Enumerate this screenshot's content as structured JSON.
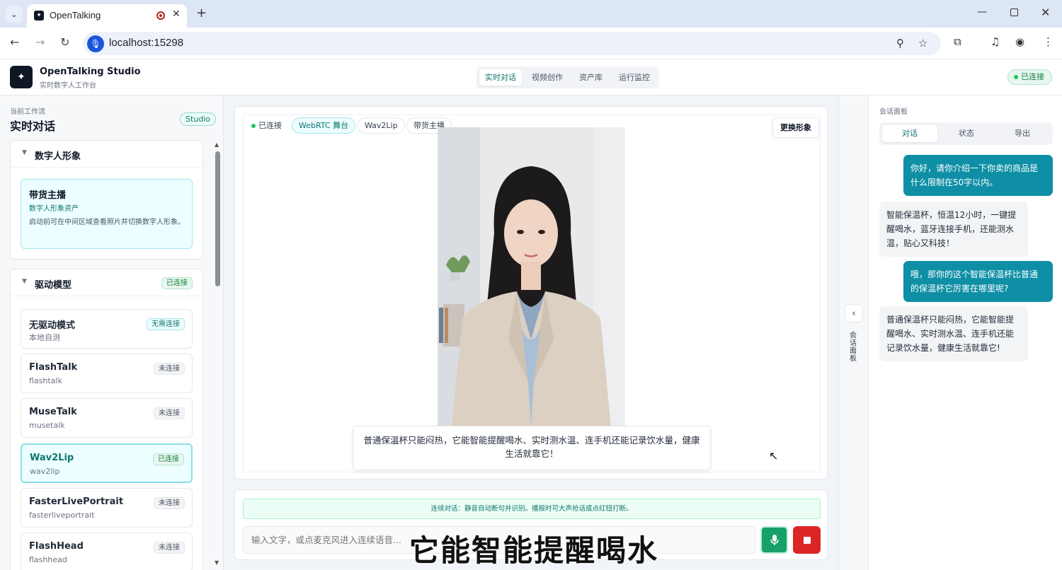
{
  "browser": {
    "tab_title": "OpenTalking",
    "url": "localhost:15298"
  },
  "header": {
    "brand_title": "OpenTalking Studio",
    "brand_subtitle": "实时数字人工作台",
    "tabs": [
      "实时对话",
      "视频创作",
      "资产库",
      "运行监控"
    ],
    "active_tab": "实时对话",
    "status": "已连接"
  },
  "sidebar": {
    "workflow_label": "当前工作流",
    "workflow_title": "实时对话",
    "studio_badge": "Studio",
    "avatar_panel": {
      "title": "数字人形象",
      "card_name": "带货主播",
      "card_subtitle": "数字人形象资产",
      "card_desc": "启动前可在中间区域查看照片并切换数字人形象。"
    },
    "model_panel": {
      "title": "驱动模型",
      "status": "已连接",
      "models": [
        {
          "name": "无驱动模式",
          "id": "本地自测",
          "status": "无需连接"
        },
        {
          "name": "FlashTalk",
          "id": "flashtalk",
          "status": "未连接"
        },
        {
          "name": "MuseTalk",
          "id": "musetalk",
          "status": "未连接"
        },
        {
          "name": "Wav2Lip",
          "id": "wav2lip",
          "status": "已连接"
        },
        {
          "name": "FasterLivePortrait",
          "id": "fasterliveportrait",
          "status": "未连接"
        },
        {
          "name": "FlashHead",
          "id": "flashhead",
          "status": "未连接"
        }
      ]
    }
  },
  "stage": {
    "chips": [
      "已连接",
      "WebRTC 舞台",
      "Wav2Lip",
      "带货主播"
    ],
    "swap_button": "更换形象",
    "caption": "普通保温杯只能闷热，它能智能提醒喝水、实时测水温、连手机还能记录饮水量，健康生活就靠它！"
  },
  "input": {
    "notice": "连续对话：静音自动断句并识别。播报时可大声抢话或点红钮打断。",
    "placeholder": "输入文字，或点麦克风进入连续语音...",
    "live_subtitle": "它能智能提醒喝水"
  },
  "rail": {
    "label": "会话面板"
  },
  "chat": {
    "panel_label": "会话面板",
    "tabs": [
      "对话",
      "状态",
      "导出"
    ],
    "active_tab": "对话",
    "messages": [
      {
        "role": "user",
        "text": "你好，请你介绍一下你卖的商品是什么限制在50字以内。"
      },
      {
        "role": "bot",
        "text": "智能保温杯，恒温12小时，一键提醒喝水，蓝牙连接手机，还能测水温，贴心又科技！"
      },
      {
        "role": "user",
        "text": "哦，那你的这个智能保温杯比普通的保温杯它厉害在哪里呢?"
      },
      {
        "role": "bot",
        "text": "普通保温杯只能闷热，它能智能提醒喝水、实时测水温、连手机还能记录饮水量，健康生活就靠它!"
      }
    ]
  },
  "colors": {
    "accent": "#0e8fa5",
    "success": "#17a067",
    "danger": "#dc2626"
  }
}
